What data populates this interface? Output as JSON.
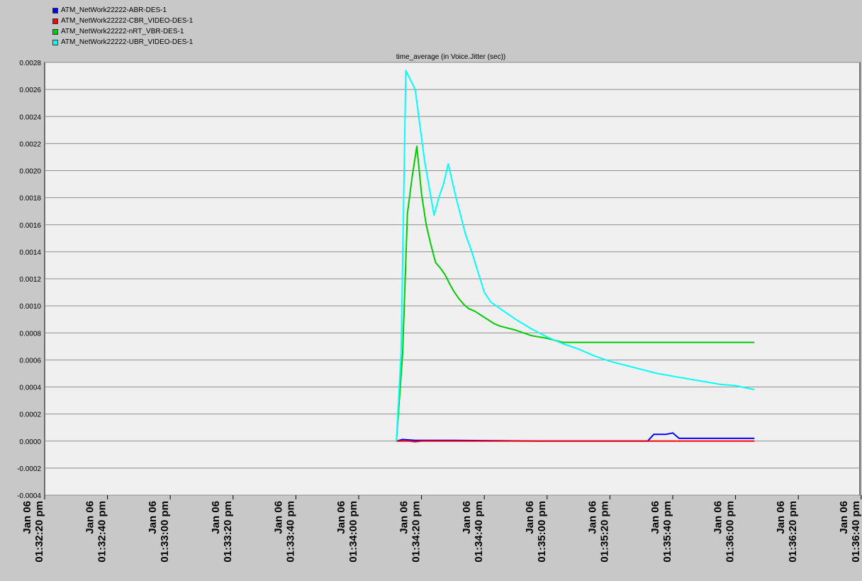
{
  "legend": [
    {
      "label": "ATM_NetWork22222-ABR-DES-1",
      "color": "#0000ff"
    },
    {
      "label": "ATM_NetWork22222-CBR_VIDEO-DES-1",
      "color": "#ff0000"
    },
    {
      "label": "ATM_NetWork22222-nRT_VBR-DES-1",
      "color": "#00cc00"
    },
    {
      "label": "ATM_NetWork22222-UBR_VIDEO-DES-1",
      "color": "#00ffff"
    }
  ],
  "chart_data": {
    "type": "line",
    "title": "time_average (in Voice.Jitter (sec))",
    "xlabel": "",
    "ylabel": "",
    "ylim": [
      -0.0004,
      0.0028
    ],
    "xlim": [
      0,
      260
    ],
    "grid": true,
    "legend_position": "top-left",
    "x_units": "seconds after Jan 06 01:32:20 pm",
    "y_ticks": [
      "0.0028",
      "0.0026",
      "0.0024",
      "0.0022",
      "0.0020",
      "0.0018",
      "0.0016",
      "0.0014",
      "0.0012",
      "0.0010",
      "0.0008",
      "0.0006",
      "0.0004",
      "0.0002",
      "0.0000",
      "-0.0002",
      "-0.0004"
    ],
    "x_ticks": [
      {
        "x": 0,
        "date": "Jan 06",
        "time": "01:32:20 pm"
      },
      {
        "x": 20,
        "date": "Jan 06",
        "time": "01:32:40 pm"
      },
      {
        "x": 40,
        "date": "Jan 06",
        "time": "01:33:00 pm"
      },
      {
        "x": 60,
        "date": "Jan 06",
        "time": "01:33:20 pm"
      },
      {
        "x": 80,
        "date": "Jan 06",
        "time": "01:33:40 pm"
      },
      {
        "x": 100,
        "date": "Jan 06",
        "time": "01:34:00 pm"
      },
      {
        "x": 120,
        "date": "Jan 06",
        "time": "01:34:20 pm"
      },
      {
        "x": 140,
        "date": "Jan 06",
        "time": "01:34:40 pm"
      },
      {
        "x": 160,
        "date": "Jan 06",
        "time": "01:35:00 pm"
      },
      {
        "x": 180,
        "date": "Jan 06",
        "time": "01:35:20 pm"
      },
      {
        "x": 200,
        "date": "Jan 06",
        "time": "01:35:40 pm"
      },
      {
        "x": 220,
        "date": "Jan 06",
        "time": "01:36:00 pm"
      },
      {
        "x": 240,
        "date": "Jan 06",
        "time": "01:36:20 pm"
      },
      {
        "x": 260,
        "date": "Jan 06",
        "time": "01:36:40 pm"
      }
    ],
    "series": [
      {
        "name": "ATM_NetWork22222-ABR-DES-1",
        "color": "#0000ff",
        "points": [
          [
            112,
            0.0
          ],
          [
            114,
            1.2e-05
          ],
          [
            118,
            5e-06
          ],
          [
            130,
            5e-06
          ],
          [
            160,
            0.0
          ],
          [
            190,
            0.0
          ],
          [
            192,
            0.0
          ],
          [
            194,
            5e-05
          ],
          [
            198,
            5e-05
          ],
          [
            200,
            6e-05
          ],
          [
            202,
            2e-05
          ],
          [
            210,
            2e-05
          ],
          [
            226,
            2e-05
          ]
        ]
      },
      {
        "name": "ATM_NetWork22222-CBR_VIDEO-DES-1",
        "color": "#ff0000",
        "points": [
          [
            112,
            0.0
          ],
          [
            116,
            0.0
          ],
          [
            118,
            -5e-06
          ],
          [
            120,
            0.0
          ],
          [
            140,
            0.0
          ],
          [
            180,
            0.0
          ],
          [
            226,
            0.0
          ]
        ]
      },
      {
        "name": "ATM_NetWork22222-nRT_VBR-DES-1",
        "color": "#00cc00",
        "points": [
          [
            112,
            0.0
          ],
          [
            114,
            0.00065
          ],
          [
            115.5,
            0.00168
          ],
          [
            117,
            0.00195
          ],
          [
            118.5,
            0.00218
          ],
          [
            120,
            0.00183
          ],
          [
            121.5,
            0.0016
          ],
          [
            123,
            0.00145
          ],
          [
            124.5,
            0.00132
          ],
          [
            126,
            0.00128
          ],
          [
            127.5,
            0.00123
          ],
          [
            129,
            0.00116
          ],
          [
            130.5,
            0.0011
          ],
          [
            132,
            0.00105
          ],
          [
            133.5,
            0.00101
          ],
          [
            135,
            0.00098
          ],
          [
            137,
            0.00096
          ],
          [
            139,
            0.00093
          ],
          [
            141,
            0.0009
          ],
          [
            143,
            0.00087
          ],
          [
            145,
            0.00085
          ],
          [
            150,
            0.00082
          ],
          [
            155,
            0.00078
          ],
          [
            160,
            0.00076
          ],
          [
            165,
            0.00073
          ],
          [
            170,
            0.00073
          ],
          [
            180,
            0.00073
          ],
          [
            190,
            0.00073
          ],
          [
            200,
            0.00073
          ],
          [
            210,
            0.00073
          ],
          [
            226,
            0.00073
          ]
        ]
      },
      {
        "name": "ATM_NetWork22222-UBR_VIDEO-DES-1",
        "color": "#00ffff",
        "points": [
          [
            112,
            0.0
          ],
          [
            113.5,
            0.00065
          ],
          [
            115,
            0.00274
          ],
          [
            118,
            0.0026
          ],
          [
            121,
            0.00207
          ],
          [
            124,
            0.00167
          ],
          [
            125.5,
            0.0018
          ],
          [
            127,
            0.0019
          ],
          [
            128.5,
            0.00205
          ],
          [
            131,
            0.0018
          ],
          [
            134,
            0.00153
          ],
          [
            136,
            0.0014
          ],
          [
            138,
            0.00125
          ],
          [
            140,
            0.0011
          ],
          [
            142,
            0.00103
          ],
          [
            145,
            0.00098
          ],
          [
            150,
            0.0009
          ],
          [
            155,
            0.00083
          ],
          [
            160,
            0.00077
          ],
          [
            165,
            0.00072
          ],
          [
            170,
            0.00068
          ],
          [
            175,
            0.00063
          ],
          [
            180,
            0.00059
          ],
          [
            185,
            0.00056
          ],
          [
            190,
            0.00053
          ],
          [
            195,
            0.0005
          ],
          [
            200,
            0.00048
          ],
          [
            205,
            0.00046
          ],
          [
            210,
            0.00044
          ],
          [
            215,
            0.00042
          ],
          [
            220,
            0.00041
          ],
          [
            226,
            0.00038
          ]
        ]
      }
    ]
  }
}
